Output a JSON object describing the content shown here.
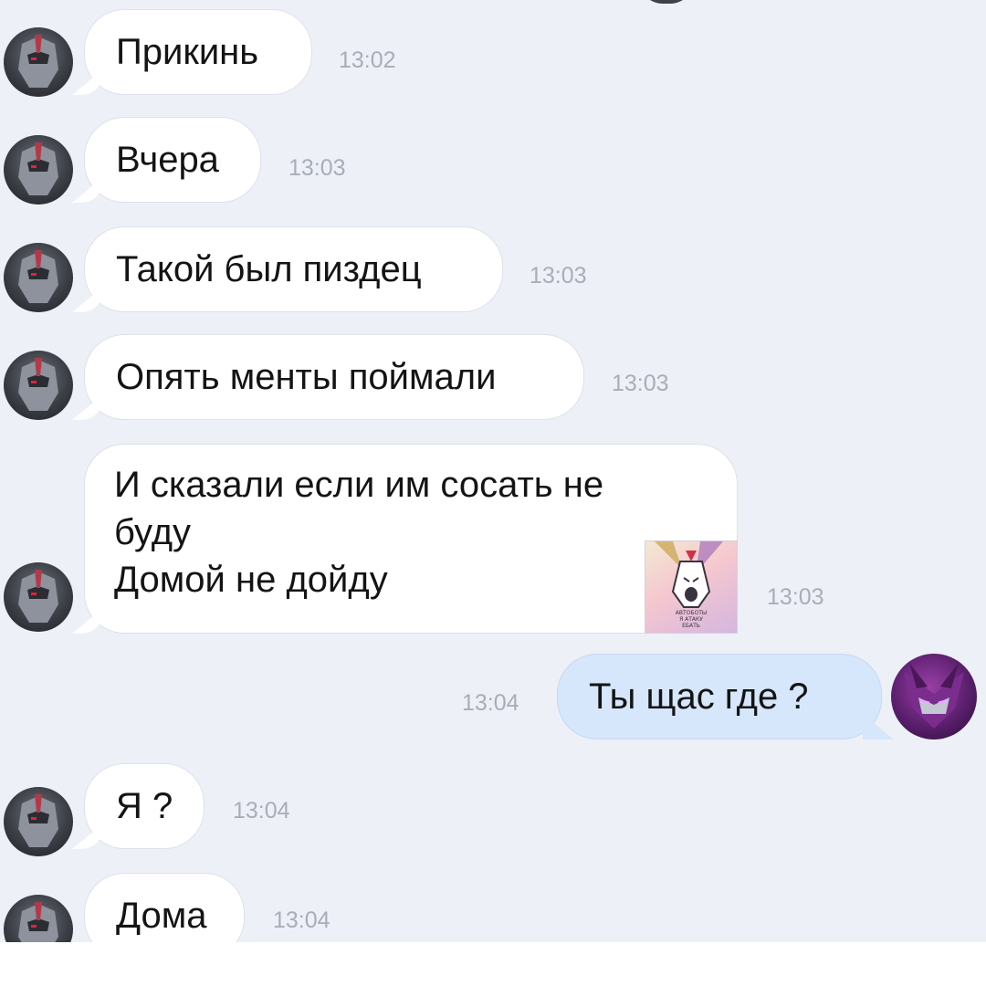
{
  "messages": [
    {
      "side": "incoming",
      "text": "Прикинь",
      "time": "13:02"
    },
    {
      "side": "incoming",
      "text": "Вчера",
      "time": "13:03"
    },
    {
      "side": "incoming",
      "text": "Такой был пиздец",
      "time": "13:03"
    },
    {
      "side": "incoming",
      "text": "Опять менты поймали",
      "time": "13:03"
    },
    {
      "side": "incoming",
      "lines": [
        "И сказали если им сосать не",
        "буду",
        "Домой не дойду"
      ],
      "time": "13:03",
      "sticker_caption": [
        "АВТОБОТЫ",
        "Я АТАКУ",
        "ЕБАТЬ"
      ]
    },
    {
      "side": "outgoing",
      "text": "Ты щас где ?",
      "time": "13:04"
    },
    {
      "side": "incoming",
      "text": "Я ?",
      "time": "13:04"
    },
    {
      "side": "incoming",
      "text": "Дома",
      "time": "13:04"
    }
  ],
  "avatars": {
    "incoming": "robot-helmet-avatar-icon",
    "outgoing": "purple-robot-avatar-icon"
  },
  "colors": {
    "background": "#edf0f7",
    "incoming_bubble": "#ffffff",
    "outgoing_bubble": "#d6e6fb",
    "timestamp": "#a8adb8"
  }
}
